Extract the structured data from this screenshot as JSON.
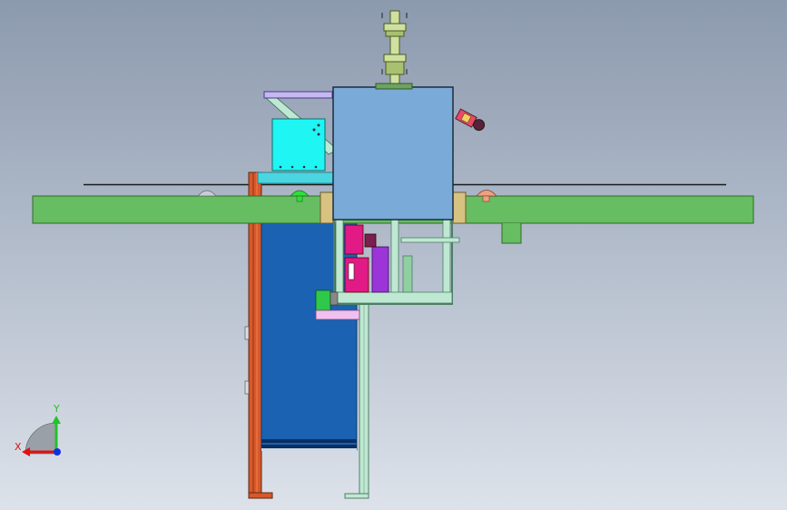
{
  "triad": {
    "x_label": "X",
    "y_label": "Y",
    "x_color": "#e01010",
    "y_color": "#22c22a",
    "z_color": "#1030e0"
  },
  "colors": {
    "beam": "#67bd61",
    "housing": "#7aaad8",
    "tank": "#1b62b2",
    "post": "#d8582a",
    "frame": "#bfe8d2",
    "motor_box": "#1ff5f3",
    "magenta_block": "#e21a86",
    "purple_block": "#9b35d8",
    "button": "#b84a62"
  }
}
